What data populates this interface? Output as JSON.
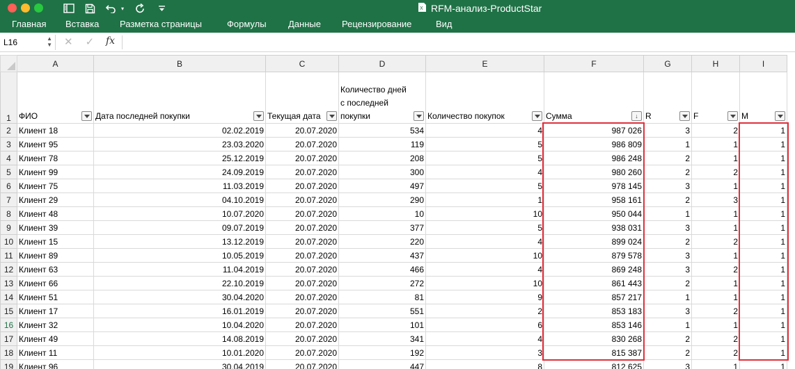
{
  "window": {
    "title": "RFM-анализ-ProductStar"
  },
  "ribbon": {
    "tabs": [
      "Главная",
      "Вставка",
      "Разметка страницы",
      "Формулы",
      "Данные",
      "Рецензирование",
      "Вид"
    ]
  },
  "formula_bar": {
    "name_box": "L16",
    "fx_label": "fx",
    "content": ""
  },
  "grid": {
    "columns": [
      "A",
      "B",
      "C",
      "D",
      "E",
      "F",
      "G",
      "H",
      "I"
    ],
    "header_row_number": "1",
    "headers": [
      "ФИО",
      "Дата последней покупки",
      "Текущая дата",
      "Количество дней с последней покупки",
      "Количество покупок",
      "Сумма",
      "R",
      "F",
      "M"
    ],
    "sorted_column_index": 5,
    "active_row": "16",
    "rows": [
      {
        "n": "2",
        "cells": [
          "Клиент 18",
          "02.02.2019",
          "20.07.2020",
          "534",
          "4",
          "987 026",
          "3",
          "2",
          "1"
        ]
      },
      {
        "n": "3",
        "cells": [
          "Клиент 95",
          "23.03.2020",
          "20.07.2020",
          "119",
          "5",
          "986 809",
          "1",
          "1",
          "1"
        ]
      },
      {
        "n": "4",
        "cells": [
          "Клиент 78",
          "25.12.2019",
          "20.07.2020",
          "208",
          "5",
          "986 248",
          "2",
          "1",
          "1"
        ]
      },
      {
        "n": "5",
        "cells": [
          "Клиент 99",
          "24.09.2019",
          "20.07.2020",
          "300",
          "4",
          "980 260",
          "2",
          "2",
          "1"
        ]
      },
      {
        "n": "6",
        "cells": [
          "Клиент 75",
          "11.03.2019",
          "20.07.2020",
          "497",
          "5",
          "978 145",
          "3",
          "1",
          "1"
        ]
      },
      {
        "n": "7",
        "cells": [
          "Клиент 29",
          "04.10.2019",
          "20.07.2020",
          "290",
          "1",
          "958 161",
          "2",
          "3",
          "1"
        ]
      },
      {
        "n": "8",
        "cells": [
          "Клиент 48",
          "10.07.2020",
          "20.07.2020",
          "10",
          "10",
          "950 044",
          "1",
          "1",
          "1"
        ]
      },
      {
        "n": "9",
        "cells": [
          "Клиент 39",
          "09.07.2019",
          "20.07.2020",
          "377",
          "5",
          "938 031",
          "3",
          "1",
          "1"
        ]
      },
      {
        "n": "10",
        "cells": [
          "Клиент 15",
          "13.12.2019",
          "20.07.2020",
          "220",
          "4",
          "899 024",
          "2",
          "2",
          "1"
        ]
      },
      {
        "n": "11",
        "cells": [
          "Клиент 89",
          "10.05.2019",
          "20.07.2020",
          "437",
          "10",
          "879 578",
          "3",
          "1",
          "1"
        ]
      },
      {
        "n": "12",
        "cells": [
          "Клиент 63",
          "11.04.2019",
          "20.07.2020",
          "466",
          "4",
          "869 248",
          "3",
          "2",
          "1"
        ]
      },
      {
        "n": "13",
        "cells": [
          "Клиент 66",
          "22.10.2019",
          "20.07.2020",
          "272",
          "10",
          "861 443",
          "2",
          "1",
          "1"
        ]
      },
      {
        "n": "14",
        "cells": [
          "Клиент 51",
          "30.04.2020",
          "20.07.2020",
          "81",
          "9",
          "857 217",
          "1",
          "1",
          "1"
        ]
      },
      {
        "n": "15",
        "cells": [
          "Клиент 17",
          "16.01.2019",
          "20.07.2020",
          "551",
          "2",
          "853 183",
          "3",
          "2",
          "1"
        ]
      },
      {
        "n": "16",
        "cells": [
          "Клиент 32",
          "10.04.2020",
          "20.07.2020",
          "101",
          "6",
          "853 146",
          "1",
          "1",
          "1"
        ]
      },
      {
        "n": "17",
        "cells": [
          "Клиент 49",
          "14.08.2019",
          "20.07.2020",
          "341",
          "4",
          "830 268",
          "2",
          "2",
          "1"
        ]
      },
      {
        "n": "18",
        "cells": [
          "Клиент 11",
          "10.01.2020",
          "20.07.2020",
          "192",
          "3",
          "815 387",
          "2",
          "2",
          "1"
        ]
      },
      {
        "n": "19",
        "cells": [
          "Клиент 96",
          "30.04.2019",
          "20.07.2020",
          "447",
          "8",
          "812 625",
          "3",
          "1",
          "1"
        ]
      }
    ]
  },
  "colors": {
    "excel_green": "#1f7246",
    "highlight_red": "#e0303b"
  }
}
